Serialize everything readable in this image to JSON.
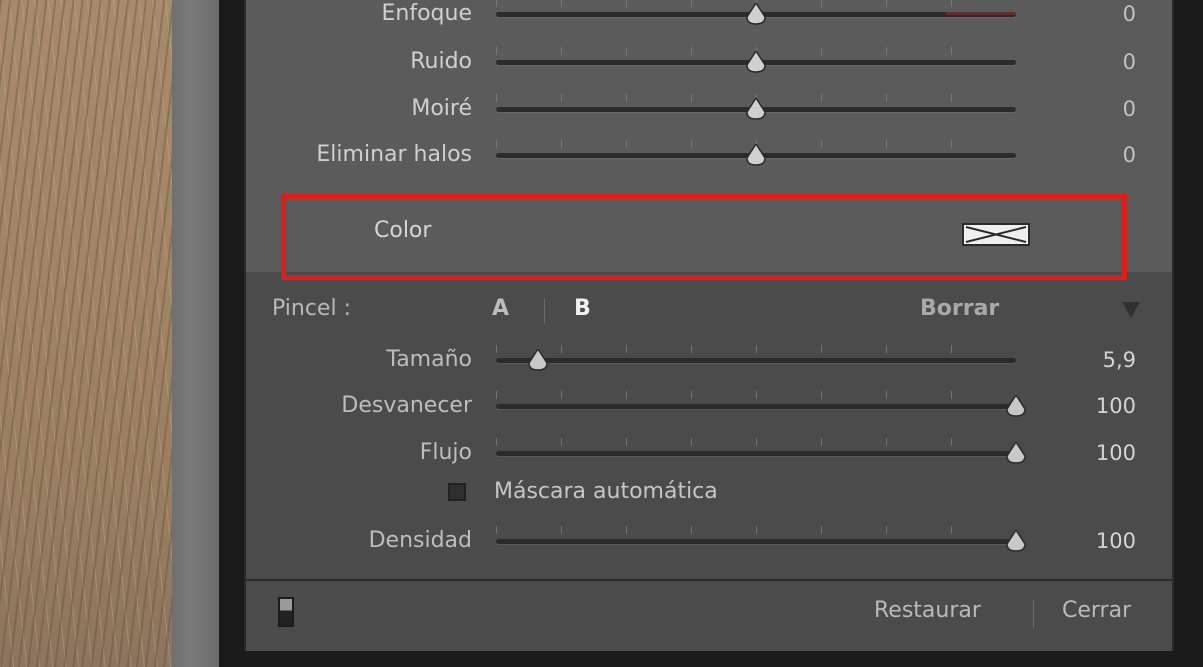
{
  "detail_sliders": [
    {
      "label": "Enfoque",
      "value": "0",
      "position": 0.5
    },
    {
      "label": "Ruido",
      "value": "0",
      "position": 0.5
    },
    {
      "label": "Moiré",
      "value": "0",
      "position": 0.5
    },
    {
      "label": "Eliminar halos",
      "value": "0",
      "position": 0.5
    }
  ],
  "color": {
    "label": "Color",
    "swatch_icon": "no-color-swatch-icon",
    "highlight_color": "#e01d1d"
  },
  "brush": {
    "label": "Pincel :",
    "option_a": "A",
    "option_b": "B",
    "selected": "B",
    "erase": "Borrar"
  },
  "brush_sliders": [
    {
      "label": "Tamaño",
      "value": "5,9",
      "position": 0.08
    },
    {
      "label": "Desvanecer",
      "value": "100",
      "position": 1.0
    },
    {
      "label": "Flujo",
      "value": "100",
      "position": 1.0
    }
  ],
  "auto_mask": {
    "label": "Máscara automática",
    "checked": false
  },
  "density": {
    "label": "Densidad",
    "value": "100",
    "position": 1.0
  },
  "footer": {
    "reset": "Restaurar",
    "close": "Cerrar"
  }
}
